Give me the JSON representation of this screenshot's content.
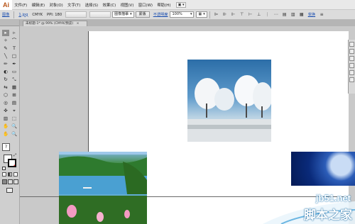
{
  "app": {
    "logo": "Ai"
  },
  "menu": {
    "items": [
      "文件(F)",
      "编辑(E)",
      "对象(O)",
      "文字(T)",
      "选择(S)",
      "效果(C)",
      "视图(V)",
      "窗口(W)",
      "帮助(H)"
    ],
    "workspace_chip": "▣ ▾"
  },
  "control_bar": {
    "label_image": "图像",
    "link_filename": "1.jpg",
    "color_mode": "CMYK",
    "ppi": "PPI: 180",
    "btn_embed": "",
    "btn_edit_original": "",
    "trace_preset": "图像描摹",
    "btn_mask": "蒙版",
    "link_opacity": "不透明度",
    "opacity_value": "100%",
    "link_transform": "变换"
  },
  "document": {
    "tab_title": "未标题-1* @ 99% (CMYK/预览)",
    "close_glyph": "×"
  },
  "tools": {
    "icons": [
      "▸",
      "▹",
      "✧",
      "⌒",
      "✎",
      "T",
      "╲",
      "□",
      "✏",
      "✒",
      "◐",
      "▭",
      "↻",
      "⤡",
      "⇆",
      "▦",
      "⬡",
      "⊞",
      "◎",
      "▤",
      "✜",
      "⌖",
      "▥",
      "⬚",
      "✋",
      "🔍",
      "?"
    ]
  },
  "colors": {
    "accent_link": "#1b4fb0",
    "watermark_blue": "#2a7fb8",
    "artboard": "#ffffff",
    "workspace": "#c9c9c9"
  },
  "watermark": {
    "url": "jb51.net",
    "site_name": "脚本之家"
  }
}
